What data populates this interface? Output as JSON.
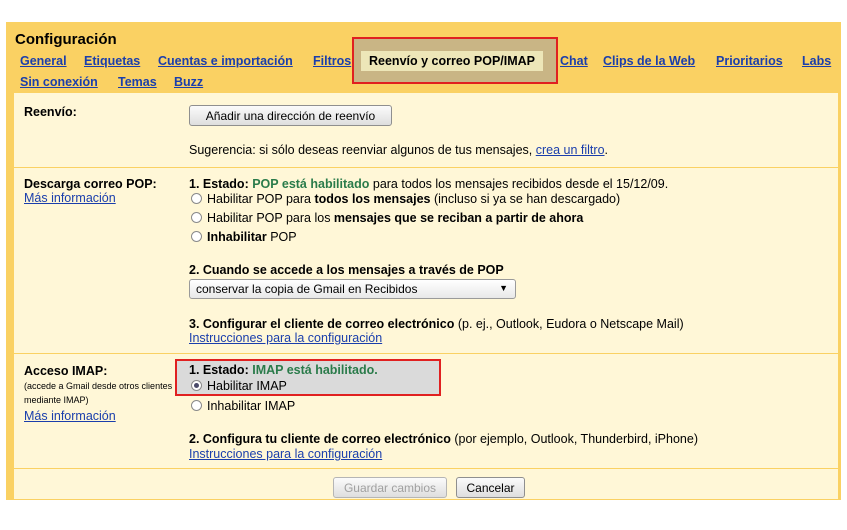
{
  "title": "Configuración",
  "tabs": [
    {
      "label": "General"
    },
    {
      "label": "Etiquetas"
    },
    {
      "label": "Cuentas e importación"
    },
    {
      "label": "Filtros"
    },
    {
      "label": "Reenvío y correo POP/IMAP"
    },
    {
      "label": "Chat"
    },
    {
      "label": "Clips de la Web"
    },
    {
      "label": "Prioritarios"
    },
    {
      "label": "Labs"
    },
    {
      "label": "Sin conexión"
    },
    {
      "label": "Temas"
    },
    {
      "label": "Buzz"
    }
  ],
  "forwarding": {
    "label": "Reenvío:",
    "add_button": "Añadir una dirección de reenvío",
    "tip_text": "Sugerencia: si sólo deseas reenviar algunos de tus mensajes, ",
    "tip_link": "crea un filtro",
    "tip_end": "."
  },
  "pop": {
    "label": "Descarga correo POP:",
    "more_info": "Más información",
    "status_prefix": "1. Estado: ",
    "status_value": "POP está habilitado",
    "status_suffix": " para todos los mensajes recibidos desde el 15/12/09.",
    "opt1_a": "Habilitar POP para ",
    "opt1_b": "todos los mensajes",
    "opt1_c": " (incluso si ya se han descargado)",
    "opt2_a": "Habilitar POP para los ",
    "opt2_b": "mensajes que se reciban a partir de ahora",
    "opt3_a": "Inhabilitar",
    "opt3_b": " POP",
    "access_heading": "2. Cuando se accede a los mensajes a través de POP",
    "access_selected": "conservar la copia de Gmail en Recibidos",
    "config_heading": "3. Configurar el cliente de correo electrónico",
    "config_suffix": " (p. ej., Outlook, Eudora o Netscape Mail)",
    "config_link": "Instrucciones para la configuración"
  },
  "imap": {
    "label": "Acceso IMAP:",
    "note": "(accede a Gmail desde otros clientes mediante IMAP)",
    "more_info": "Más información",
    "status_prefix": "1. Estado: ",
    "status_value": "IMAP está habilitado.",
    "opt_enable": "Habilitar IMAP",
    "opt_disable": "Inhabilitar IMAP",
    "config_heading": "2. Configura tu cliente de correo electrónico",
    "config_suffix": " (por ejemplo, Outlook, Thunderbird, iPhone)",
    "config_link": "Instrucciones para la configuración"
  },
  "actions": {
    "save": "Guardar cambios",
    "cancel": "Cancelar"
  }
}
